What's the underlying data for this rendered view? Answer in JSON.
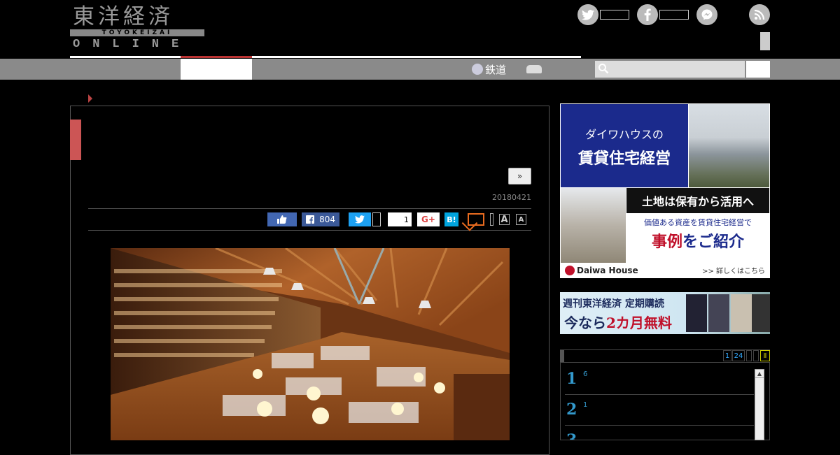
{
  "header": {
    "logo_kanji": "東洋経済",
    "logo_latin": "TOYOKEIZAI",
    "logo_online": "ONLINE",
    "social": [
      {
        "name": "twitter",
        "glyph": "t"
      },
      {
        "name": "facebook",
        "glyph": "f"
      },
      {
        "name": "messenger",
        "glyph": "~"
      },
      {
        "name": "rss",
        "glyph": "))"
      }
    ]
  },
  "nav": {
    "items": [
      {
        "label": "鉄道",
        "icon": "train-icon"
      },
      {
        "label": "",
        "icon": "car-icon"
      }
    ],
    "search_placeholder": ""
  },
  "article": {
    "next_label": "»",
    "date": "20180421",
    "share": {
      "fb_count": "804",
      "pocket_count": "1",
      "gplus_label": "G+",
      "hatena_label": "B!"
    },
    "font_small": "A",
    "font_large": "A"
  },
  "sidebar": {
    "ad1": {
      "line1": "ダイワハウスの",
      "line2": "賃貸住宅経営",
      "headline": "土地は保有から活用へ",
      "sub": "価値ある資産を賃貸住宅経営で",
      "big_red": "事例",
      "big_rest": "をご紹介",
      "brand": "Daiwa House",
      "link": ">> 詳しくはこちら"
    },
    "ad2": {
      "line1": "週刊東洋経済 定期購読",
      "line2_a": "今なら",
      "line2_b": "2カ月無料"
    },
    "ranking": {
      "tabs": [
        "1",
        "24",
        "",
        ""
      ],
      "items": [
        {
          "num": "1",
          "text": "6"
        },
        {
          "num": "2",
          "text": "1"
        },
        {
          "num": "3",
          "text": ""
        }
      ]
    }
  },
  "colors": {
    "nav_gray": "#8a8a8a",
    "accent_red": "#c55",
    "facebook": "#3b5998",
    "twitter": "#1da1f2",
    "hatena": "#00a4de",
    "daiwa_blue": "#1b2a8c"
  }
}
